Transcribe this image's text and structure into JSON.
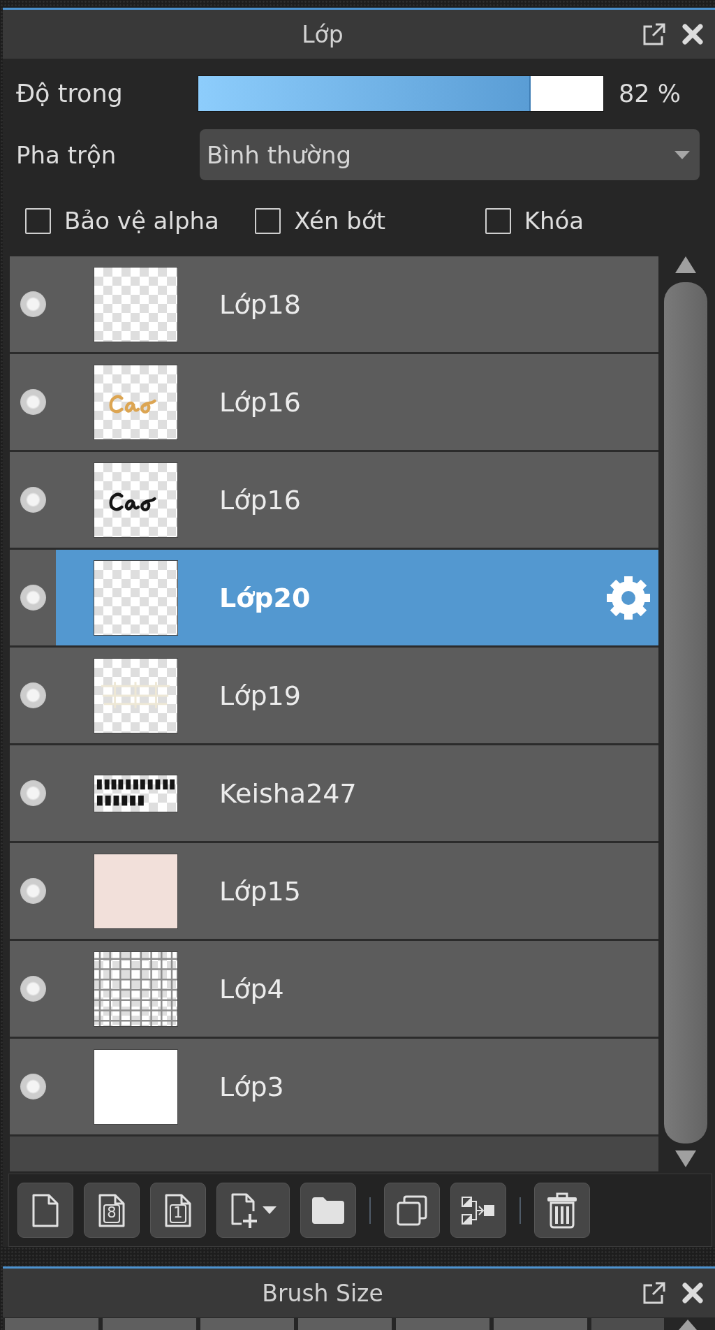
{
  "panel": {
    "title": "Lớp"
  },
  "opacity": {
    "label": "Độ trong",
    "level": 0.82,
    "reading": "82 %"
  },
  "blend_mode": {
    "label": "Pha trộn",
    "value": "Bình thường"
  },
  "options": [
    {
      "label": "Bảo vệ alpha",
      "checked": false
    },
    {
      "label": "Xén bớt",
      "checked": false
    },
    {
      "label": "Khóa",
      "checked": false
    }
  ],
  "layers": [
    {
      "name": "Lớp18",
      "visible": true,
      "selected": false,
      "thumbnail": {
        "kind": "empty"
      }
    },
    {
      "name": "Lớp16",
      "visible": true,
      "selected": false,
      "thumbnail": {
        "kind": "script",
        "color": "#dca552"
      }
    },
    {
      "name": "Lớp16",
      "visible": true,
      "selected": false,
      "thumbnail": {
        "kind": "script",
        "color": "#151515"
      }
    },
    {
      "name": "Lớp20",
      "visible": true,
      "selected": true,
      "thumbnail": {
        "kind": "empty"
      }
    },
    {
      "name": "Lớp19",
      "visible": true,
      "selected": false,
      "thumbnail": {
        "kind": "lines",
        "color": "#eee8d6"
      }
    },
    {
      "name": "Keisha247",
      "visible": true,
      "selected": false,
      "thumbnail": {
        "kind": "text",
        "color": "#151515"
      }
    },
    {
      "name": "Lớp15",
      "visible": true,
      "selected": false,
      "thumbnail": {
        "kind": "solid",
        "color": "#f2e0da"
      }
    },
    {
      "name": "Lớp4",
      "visible": true,
      "selected": false,
      "thumbnail": {
        "kind": "lattice"
      }
    },
    {
      "name": "Lớp3",
      "visible": true,
      "selected": false,
      "thumbnail": {
        "kind": "solid",
        "color": "#ffffff"
      }
    }
  ],
  "toolbar": [
    {
      "kind": "new"
    },
    {
      "kind": "numbered",
      "label": "8"
    },
    {
      "kind": "numbered",
      "label": "1"
    },
    {
      "kind": "add-menu"
    },
    {
      "kind": "folder"
    },
    {
      "kind": "separator"
    },
    {
      "kind": "duplicate"
    },
    {
      "kind": "merge"
    },
    {
      "kind": "separator"
    },
    {
      "kind": "delete"
    }
  ],
  "brush_panel": {
    "title": "Brush Size"
  }
}
